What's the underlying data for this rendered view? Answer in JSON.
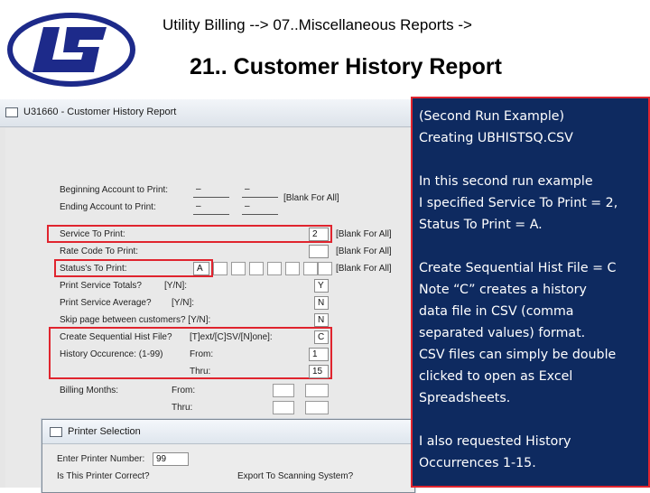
{
  "header": {
    "subtitle": "Utility Billing -->   07..Miscellaneous Reports ->",
    "title": "21.. Customer History Report"
  },
  "window": {
    "title": "U31660 - Customer History Report"
  },
  "form": {
    "beginning_account_label": "Beginning Account to Print:",
    "beginning_account_value_1": "–",
    "beginning_account_value_2": "–",
    "ending_account_label": "Ending   Account to Print:",
    "ending_account_value_1": "–",
    "ending_account_value_2": "–",
    "account_blank_note": "[Blank For All]",
    "service_label": "Service To Print:",
    "service_value": "2",
    "service_note": "[Blank For All]",
    "rate_code_label": "Rate Code To Print:",
    "rate_code_note": "[Blank For All]",
    "status_label": "Status's To Print:",
    "status_value": "A",
    "status_note": "[Blank For All]",
    "print_totals_label": "Print Service Totals?",
    "print_totals_hint": "[Y/N]:",
    "print_totals_value": "Y",
    "print_average_label": "Print Service Average?",
    "print_average_hint": "[Y/N]:",
    "print_average_value": "N",
    "skip_page_label": "Skip page between customers? [Y/N]:",
    "skip_page_value": "N",
    "seq_file_label": "Create Sequential Hist File?",
    "seq_file_hint": "[T]ext/[C]SV/[N]one]:",
    "seq_file_value": "C",
    "history_label": "History Occurence: (1-99)",
    "history_from_label": "From:",
    "history_from_value": "1",
    "history_thru_label": "Thru:",
    "history_thru_value": "15",
    "billing_months_label": "Billing Months:",
    "billing_from_label": "From:",
    "billing_thru_label": "Thru:"
  },
  "printer_dialog": {
    "title": "Printer Selection",
    "printer_number_label": "Enter Printer Number:",
    "printer_number_value": "99",
    "printer_correct_label": "Is This Printer Correct?",
    "export_label": "Export To Scanning System?"
  },
  "note": {
    "p1_line1": "(Second Run Example)",
    "p1_line2": "Creating UBHISTSQ.CSV",
    "p2_line1": "In this second run example",
    "p2_line2": "I specified Service To Print = 2,",
    "p2_line3": "Status To Print = A.",
    "p3_line1": "Create Sequential Hist File = C",
    "p3_line2": "Note “C” creates a history",
    "p3_line3": "data file in CSV (comma",
    "p3_line4": "separated values) format.",
    "p3_line5": "CSV files can simply be double",
    "p3_line6": "clicked to open as Excel",
    "p3_line7": "Spreadsheets.",
    "p4_line1": "I also requested History",
    "p4_line2": "Occurrences 1-15."
  },
  "colors": {
    "highlight": "#e0242e",
    "note_background": "#0e2a60",
    "logo_blue": "#1d2a8a"
  }
}
